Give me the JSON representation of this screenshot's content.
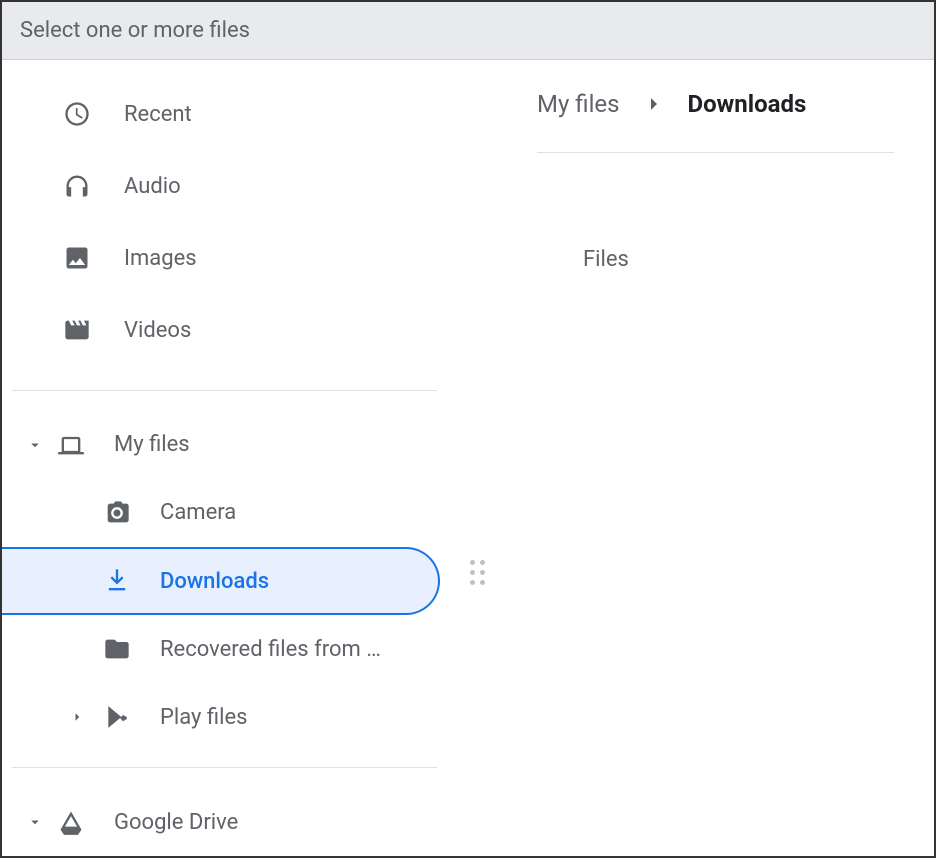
{
  "title": "Select one or more files",
  "sidebar": {
    "quick": [
      {
        "label": "Recent"
      },
      {
        "label": "Audio"
      },
      {
        "label": "Images"
      },
      {
        "label": "Videos"
      }
    ],
    "myfiles_label": "My files",
    "children": {
      "camera": "Camera",
      "downloads": "Downloads",
      "recovered": "Recovered files from …",
      "play": "Play files"
    },
    "drive_label": "Google Drive"
  },
  "breadcrumb": {
    "root": "My files",
    "current": "Downloads"
  },
  "main": {
    "files_heading": "Files"
  }
}
